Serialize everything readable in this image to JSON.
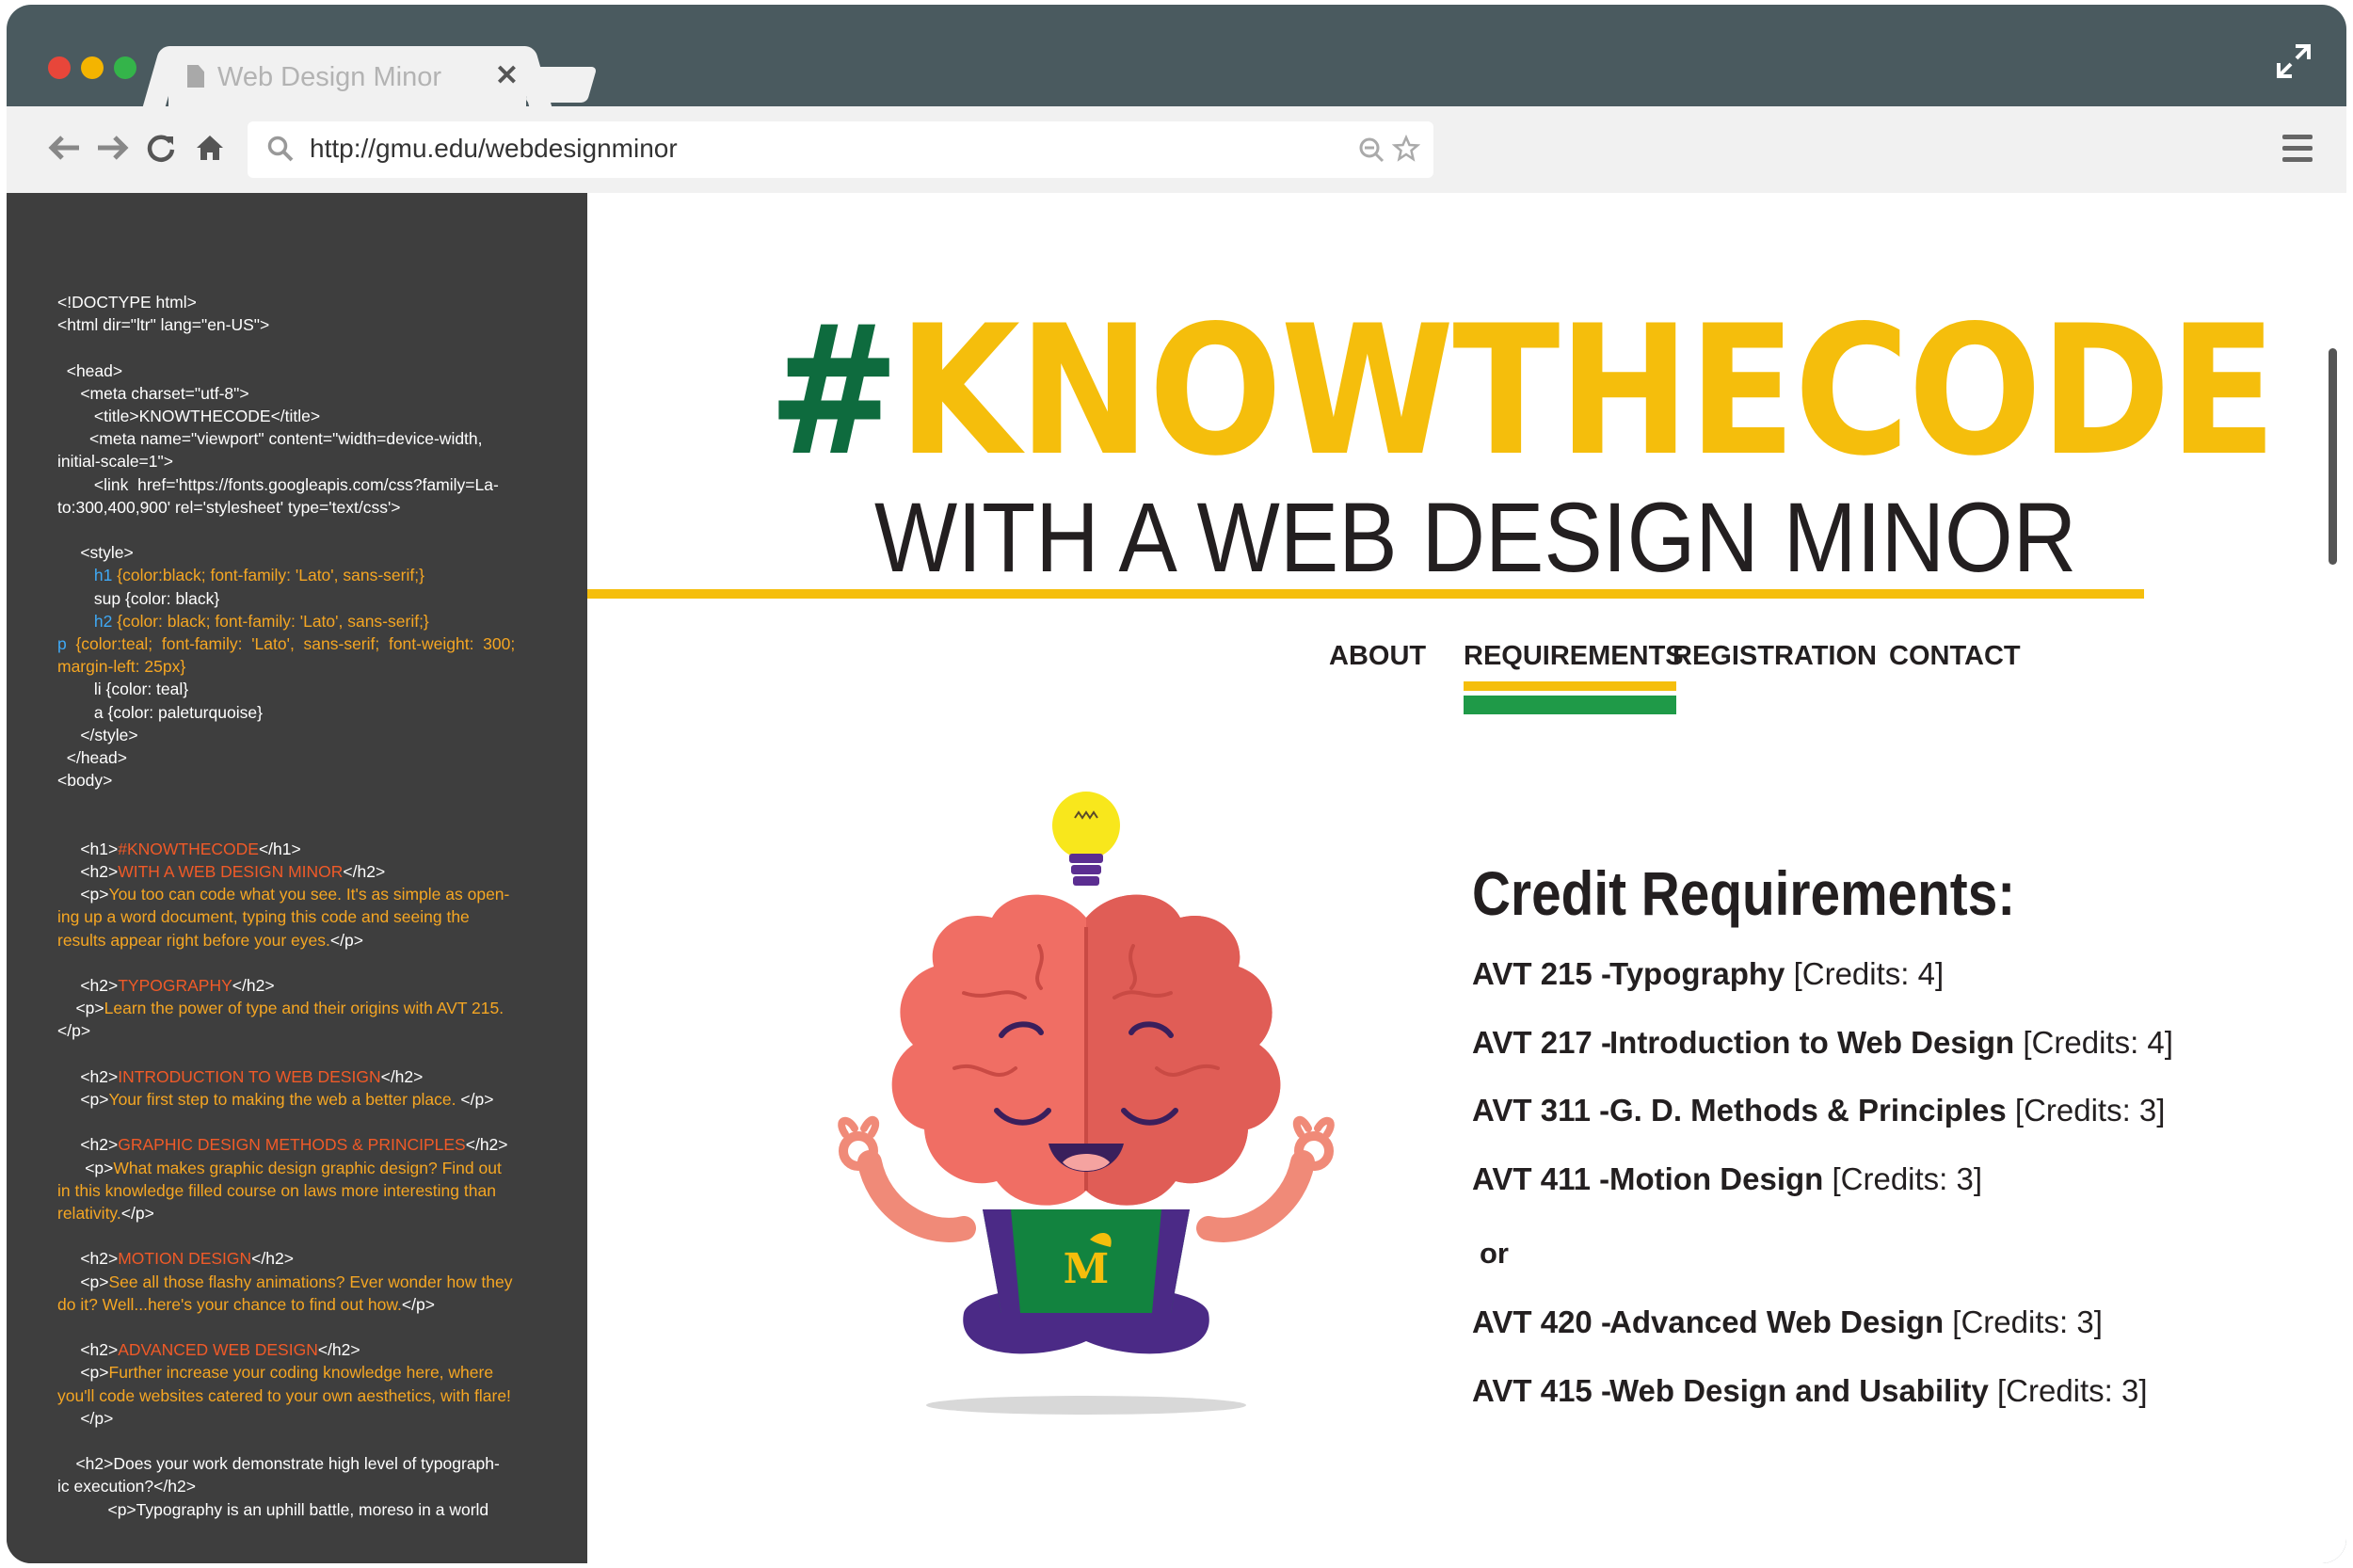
{
  "browser": {
    "tab_title": "Web Design Minor",
    "tab_close": "✕",
    "url": "http://gmu.edu/webdesignminor"
  },
  "code": [
    [
      {
        "t": "<!DOCTYPE html>"
      }
    ],
    [
      {
        "t": "<html dir=\"ltr\" lang=\"en-US\">"
      }
    ],
    [],
    [
      {
        "t": "  <head>"
      }
    ],
    [
      {
        "t": "     <meta charset=\"utf-8\">"
      }
    ],
    [
      {
        "t": "        <title>KNOWTHECODE</title>"
      }
    ],
    [
      {
        "t": "       <meta name=\"viewport\" content=\"width=device-width,"
      }
    ],
    [
      {
        "t": "initial-scale=1\">"
      }
    ],
    [
      {
        "t": "        <link  href='https://fonts.googleapis.com/css?family=La-"
      }
    ],
    [
      {
        "t": "to:300,400,900' rel='stylesheet' type='text/css'>"
      }
    ],
    [],
    [
      {
        "t": "     <style>"
      }
    ],
    [
      {
        "t": "        ",
        "c": "w"
      },
      {
        "t": "h1",
        "c": "b"
      },
      {
        "t": " {color:black; font-family: 'Lato', sans-serif;}",
        "c": "o"
      }
    ],
    [
      {
        "t": "        sup {color: black}"
      }
    ],
    [
      {
        "t": "        ",
        "c": "w"
      },
      {
        "t": "h2",
        "c": "b"
      },
      {
        "t": " {color: black; font-family: 'Lato', sans-serif;}",
        "c": "o"
      }
    ],
    [
      {
        "t": "p",
        "c": "b"
      },
      {
        "t": "  {color:teal;  font-family:  'Lato',  sans-serif;  font-weight:  300;",
        "c": "o"
      }
    ],
    [
      {
        "t": "margin-left: 25px}",
        "c": "o"
      }
    ],
    [
      {
        "t": "        li {color: teal}"
      }
    ],
    [
      {
        "t": "        a {color: paleturquoise}"
      }
    ],
    [
      {
        "t": "     </style>"
      }
    ],
    [
      {
        "t": "  </head>"
      }
    ],
    [
      {
        "t": "<body>"
      }
    ],
    [],
    [],
    [
      {
        "t": "     <h1>"
      },
      {
        "t": "#KNOWTHECODE",
        "c": "t"
      },
      {
        "t": "</h1>"
      }
    ],
    [
      {
        "t": "     <h2>"
      },
      {
        "t": "WITH A WEB DESIGN MINOR",
        "c": "t"
      },
      {
        "t": "</h2>"
      }
    ],
    [
      {
        "t": "     <p>"
      },
      {
        "t": "You too can code what you see. It's as simple as open-",
        "c": "o"
      }
    ],
    [
      {
        "t": "ing up a word document, typing this code and seeing the",
        "c": "o"
      }
    ],
    [
      {
        "t": "results appear right before your eyes.",
        "c": "o"
      },
      {
        "t": "</p>"
      }
    ],
    [],
    [
      {
        "t": "     <h2>"
      },
      {
        "t": "TYPOGRAPHY",
        "c": "t"
      },
      {
        "t": "</h2>"
      }
    ],
    [
      {
        "t": "    <p>"
      },
      {
        "t": "Learn the power of type and their origins with AVT 215.",
        "c": "o"
      }
    ],
    [
      {
        "t": "</p>"
      }
    ],
    [],
    [
      {
        "t": "     <h2>"
      },
      {
        "t": "INTRODUCTION TO WEB DESIGN",
        "c": "t"
      },
      {
        "t": "</h2>"
      }
    ],
    [
      {
        "t": "     <p>"
      },
      {
        "t": "Your first step to making the web a better place.",
        "c": "o"
      },
      {
        "t": " </p>"
      }
    ],
    [],
    [
      {
        "t": "     <h2>"
      },
      {
        "t": "GRAPHIC DESIGN METHODS & PRINCIPLES",
        "c": "t"
      },
      {
        "t": "</h2>"
      }
    ],
    [
      {
        "t": "      <p>"
      },
      {
        "t": "What makes graphic design graphic design? Find out",
        "c": "o"
      }
    ],
    [
      {
        "t": "in this knowledge filled course on laws more interesting than",
        "c": "o"
      }
    ],
    [
      {
        "t": "relativity.",
        "c": "o"
      },
      {
        "t": "</p>"
      }
    ],
    [],
    [
      {
        "t": "     <h2>"
      },
      {
        "t": "MOTION DESIGN",
        "c": "t"
      },
      {
        "t": "</h2>"
      }
    ],
    [
      {
        "t": "     <p>"
      },
      {
        "t": "See all those flashy animations? Ever wonder how they",
        "c": "o"
      }
    ],
    [
      {
        "t": "do it? Well...here's your chance to find out how.",
        "c": "o"
      },
      {
        "t": "</p>"
      }
    ],
    [],
    [
      {
        "t": "     <h2>"
      },
      {
        "t": "ADVANCED WEB DESIGN",
        "c": "t"
      },
      {
        "t": "</h2>"
      }
    ],
    [
      {
        "t": "     <p>"
      },
      {
        "t": "Further increase your coding knowledge here, where",
        "c": "o"
      }
    ],
    [
      {
        "t": "you'll code websites catered to your own aesthetics, with flare!",
        "c": "o"
      }
    ],
    [
      {
        "t": "     </p>"
      }
    ],
    [],
    [
      {
        "t": "    <h2>Does your work demonstrate high level of typograph-"
      }
    ],
    [
      {
        "t": "ic execution?</h2>"
      }
    ],
    [
      {
        "t": "           <p>Typography is an uphill battle, moreso in a world"
      }
    ]
  ],
  "site": {
    "headline_hash": "#",
    "headline_word": "KNOWTHECODE",
    "subhead": "WITH A WEB DESIGN MINOR",
    "nav": [
      "ABOUT",
      "REQUIREMENTS",
      "REGISTRATION",
      "CONTACT"
    ],
    "credit_title": "Credit Requirements:",
    "courses_a": [
      {
        "code": "AVT 215 -",
        "name": "Typography",
        "credits": "[Credits: 4]"
      },
      {
        "code": "AVT 217 -",
        "name": "Introduction to Web Design",
        "credits": "[Credits: 4]"
      },
      {
        "code": "AVT 311 -",
        "name": "G. D. Methods & Principles",
        "credits": "[Credits: 3]"
      },
      {
        "code": "AVT 411 -",
        "name": "Motion Design",
        "credits": "[Credits: 3]"
      }
    ],
    "or_label": "or",
    "courses_b": [
      {
        "code": "AVT 420 -",
        "name": "Advanced Web Design",
        "credits": "[Credits: 3]"
      },
      {
        "code": "AVT 415 -",
        "name": "Web Design and Usability",
        "credits": "[Credits: 3]"
      }
    ],
    "mascot_shirt_letter": "M"
  },
  "colors": {
    "frame": "#4a5a5f",
    "accent_yellow": "#f5be0c",
    "accent_green": "#0e6b3e",
    "nav_green": "#1f9a48",
    "code_tag": "#f05a28",
    "code_text": "#f5a623",
    "code_selector": "#3fa9f5"
  }
}
